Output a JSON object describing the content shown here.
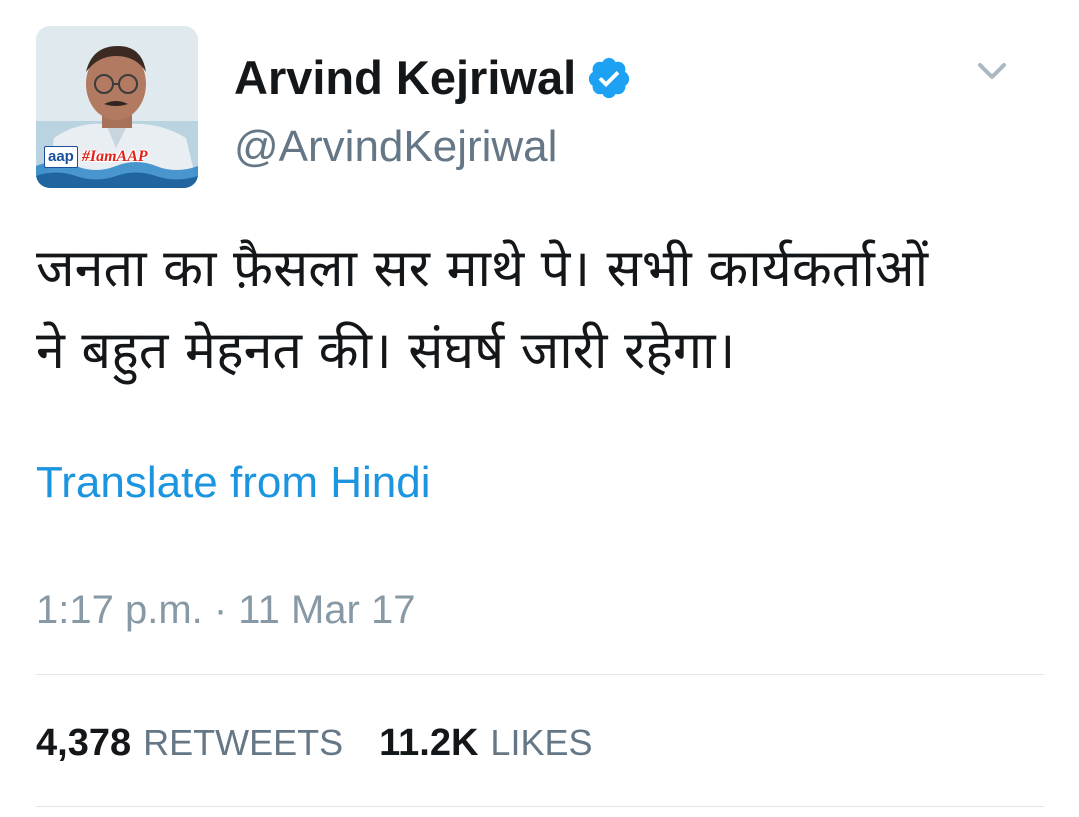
{
  "author": {
    "display_name": "Arvind Kejriwal",
    "handle": "@ArvindKejriwal",
    "verified": true,
    "avatar_badge": {
      "logo_text": "aap",
      "hashtag": "#IamAAP"
    }
  },
  "tweet": {
    "text_lines": [
      "जनता का फ़ैसला सर माथे पे। सभी कार्यकर्ताओं",
      "ने बहुत मेहनत की। संघर्ष जारी रहेगा।"
    ],
    "translate_label": "Translate from Hindi",
    "timestamp": "1:17 p.m. · 11 Mar 17"
  },
  "stats": {
    "retweets_count": "4,378",
    "retweets_label": "RETWEETS",
    "likes_count": "11.2K",
    "likes_label": "LIKES"
  },
  "colors": {
    "link": "#1b95e0",
    "verified": "#1da1f2",
    "muted": "#657786",
    "divider": "#e1e8ed"
  },
  "icons": {
    "verified": "verified-badge-icon",
    "menu": "chevron-down-icon"
  }
}
